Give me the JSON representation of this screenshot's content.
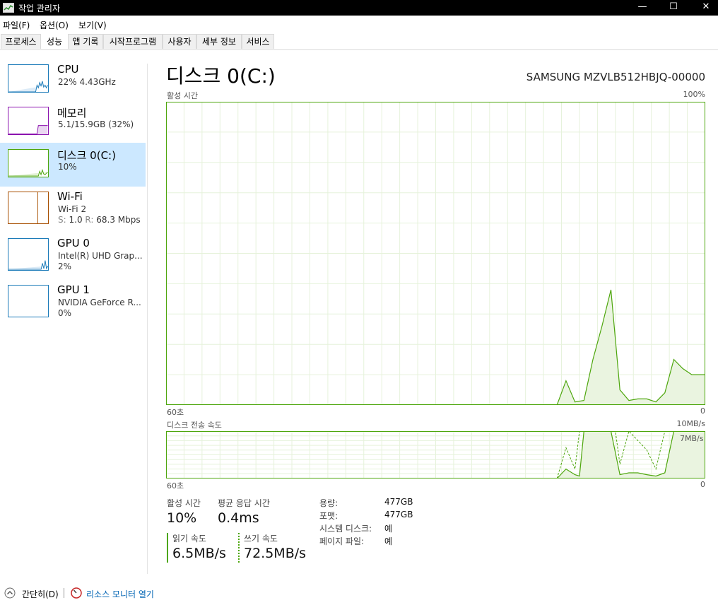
{
  "window": {
    "title": "작업 관리자"
  },
  "menu": [
    "파일(F)",
    "옵션(O)",
    "보기(V)"
  ],
  "tabs": [
    "프로세스",
    "성능",
    "앱 기록",
    "시작프로그램",
    "사용자",
    "세부 정보",
    "서비스"
  ],
  "active_tab": "성능",
  "sidebar": {
    "cpu": {
      "name": "CPU",
      "sub": "22% 4.43GHz",
      "color": "#1a7ab8"
    },
    "memory": {
      "name": "메모리",
      "sub": "5.1/15.9GB (32%)",
      "color": "#8b12ae"
    },
    "disk": {
      "name": "디스크 0(C:)",
      "sub": "10%",
      "color": "#4da60c"
    },
    "wifi": {
      "name": "Wi-Fi",
      "sub": "Wi-Fi 2",
      "sub2_s": "S:",
      "sub2_s_val": "1.0",
      "sub2_r": "R:",
      "sub2_r_val": "68.3 Mbps",
      "color": "#a74f01"
    },
    "gpu0": {
      "name": "GPU 0",
      "sub": "Intel(R) UHD Grap...",
      "sub2": "2%",
      "color": "#1a7ab8"
    },
    "gpu1": {
      "name": "GPU 1",
      "sub": "NVIDIA GeForce R...",
      "sub2": "0%",
      "color": "#1a7ab8"
    }
  },
  "main": {
    "title": "디스크 0(C:)",
    "device": "SAMSUNG MZVLB512HBJQ-00000",
    "active_time_label": "활성 시간",
    "active_time_max": "100%",
    "time_span": "60초",
    "time_end": "0",
    "transfer_label": "디스크 전송 속도",
    "transfer_max": "10MB/s",
    "transfer_mid": "7MB/s"
  },
  "stats": {
    "active_time": {
      "label": "활성 시간",
      "value": "10%"
    },
    "avg_response": {
      "label": "평균 응답 시간",
      "value": "0.4ms"
    },
    "read": {
      "label": "읽기 속도",
      "value": "6.5MB/s"
    },
    "write": {
      "label": "쓰기 속도",
      "value": "72.5MB/s"
    }
  },
  "info": [
    {
      "key": "용량:",
      "value": "477GB"
    },
    {
      "key": "포맷:",
      "value": "477GB"
    },
    {
      "key": "시스템 디스크:",
      "value": "예"
    },
    {
      "key": "페이지 파일:",
      "value": "예"
    }
  ],
  "footer": {
    "fewer_details": "간단히(D)",
    "resource_monitor": "리소스 모니터 열기"
  },
  "chart_data": [
    {
      "type": "area",
      "title": "활성 시간",
      "x": [
        60,
        58,
        56,
        54,
        52,
        50,
        48,
        46,
        44,
        42,
        40,
        38,
        36,
        34,
        32,
        30,
        28,
        26,
        24,
        22,
        20,
        18,
        16,
        14,
        12,
        10,
        8,
        6,
        4,
        2,
        0
      ],
      "series": [
        {
          "values": [
            0,
            0,
            0,
            0,
            0,
            0,
            0,
            0,
            0,
            0,
            0,
            0,
            0,
            0,
            0,
            0,
            0,
            0,
            0,
            0,
            0,
            0,
            0,
            0,
            0,
            0,
            0,
            0,
            0,
            0,
            0
          ]
        }
      ],
      "points": [
        [
          16.5,
          0
        ],
        [
          15.5,
          8
        ],
        [
          14.5,
          1
        ],
        [
          13.5,
          1.5
        ],
        [
          12.5,
          15
        ],
        [
          11.5,
          26
        ],
        [
          10.5,
          38
        ],
        [
          9.5,
          5
        ],
        [
          8.5,
          1.5
        ],
        [
          7.5,
          2
        ],
        [
          6.5,
          2
        ],
        [
          5.5,
          1
        ],
        [
          4.5,
          4
        ],
        [
          3.5,
          15
        ],
        [
          2.5,
          12
        ],
        [
          1.5,
          10
        ],
        [
          0,
          10
        ]
      ],
      "ylim": [
        0,
        100
      ],
      "xlim": [
        60,
        0
      ],
      "grid": true
    },
    {
      "type": "area",
      "title": "디스크 전송 속도",
      "points": [
        [
          16.5,
          0
        ],
        [
          15.5,
          2
        ],
        [
          14.5,
          0.8
        ],
        [
          14,
          0.5
        ],
        [
          13.5,
          10
        ],
        [
          12.5,
          10
        ],
        [
          11.5,
          10
        ],
        [
          10.5,
          10
        ],
        [
          9.5,
          0.8
        ],
        [
          8.5,
          1.2
        ],
        [
          7.5,
          1.2
        ],
        [
          6.5,
          0.8
        ],
        [
          5.5,
          0.5
        ],
        [
          4.5,
          1.2
        ],
        [
          3.5,
          10
        ],
        [
          2.5,
          10
        ],
        [
          1.5,
          10
        ],
        [
          0,
          10
        ]
      ],
      "dashed_points": [
        [
          16.5,
          0
        ],
        [
          15.5,
          6.5
        ],
        [
          14.5,
          2
        ],
        [
          14,
          10
        ],
        [
          13,
          10
        ],
        [
          12,
          10
        ],
        [
          11,
          10
        ],
        [
          10,
          10
        ],
        [
          9.5,
          3
        ],
        [
          8.5,
          10
        ],
        [
          7.5,
          8
        ],
        [
          6.5,
          6
        ],
        [
          5.5,
          2
        ],
        [
          4.5,
          10
        ],
        [
          3.5,
          10
        ],
        [
          2.5,
          10
        ],
        [
          0,
          10
        ]
      ],
      "ylim": [
        0,
        10
      ],
      "xlim": [
        60,
        0
      ],
      "grid": true
    }
  ]
}
